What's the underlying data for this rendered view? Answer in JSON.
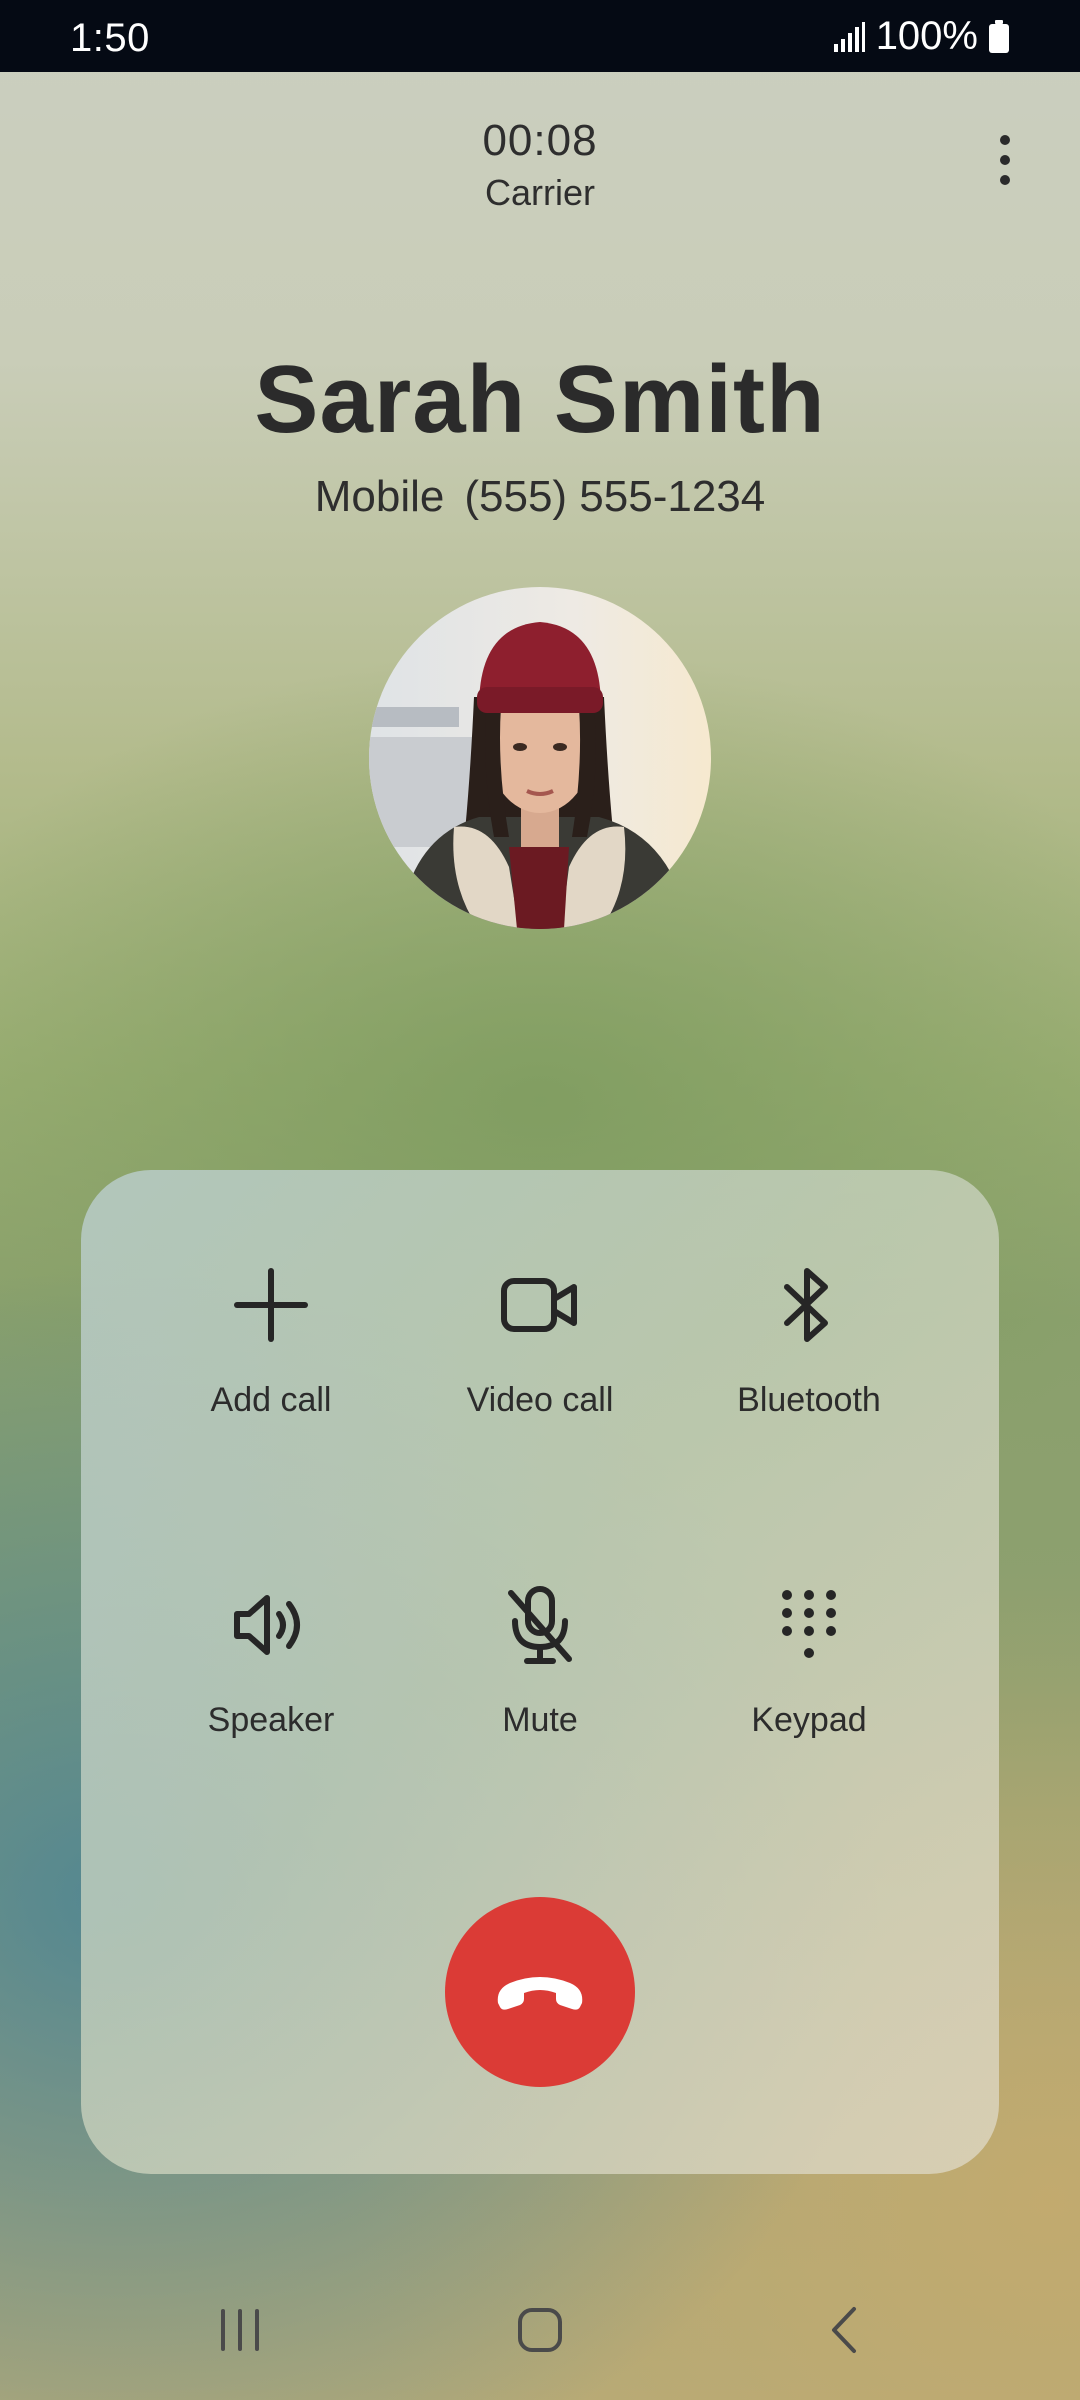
{
  "status_bar": {
    "time": "1:50",
    "battery_percent": "100%",
    "icons": [
      "signal-icon",
      "battery-icon"
    ],
    "background": "#050a14"
  },
  "call": {
    "timer": "00:08",
    "carrier": "Carrier",
    "contact_name": "Sarah Smith",
    "number_type": "Mobile",
    "number": "(555) 555-1234"
  },
  "controls": [
    {
      "id": "add-call",
      "label": "Add call",
      "icon": "plus-icon"
    },
    {
      "id": "video-call",
      "label": "Video call",
      "icon": "video-camera-icon"
    },
    {
      "id": "bluetooth",
      "label": "Bluetooth",
      "icon": "bluetooth-icon"
    },
    {
      "id": "speaker",
      "label": "Speaker",
      "icon": "speaker-icon"
    },
    {
      "id": "mute",
      "label": "Mute",
      "icon": "microphone-off-icon"
    },
    {
      "id": "keypad",
      "label": "Keypad",
      "icon": "keypad-icon"
    }
  ],
  "end_call": {
    "icon": "phone-hangup-icon",
    "color": "#db3b36"
  },
  "nav_bar": {
    "icons": [
      "recent-apps-icon",
      "home-icon",
      "back-icon"
    ]
  }
}
